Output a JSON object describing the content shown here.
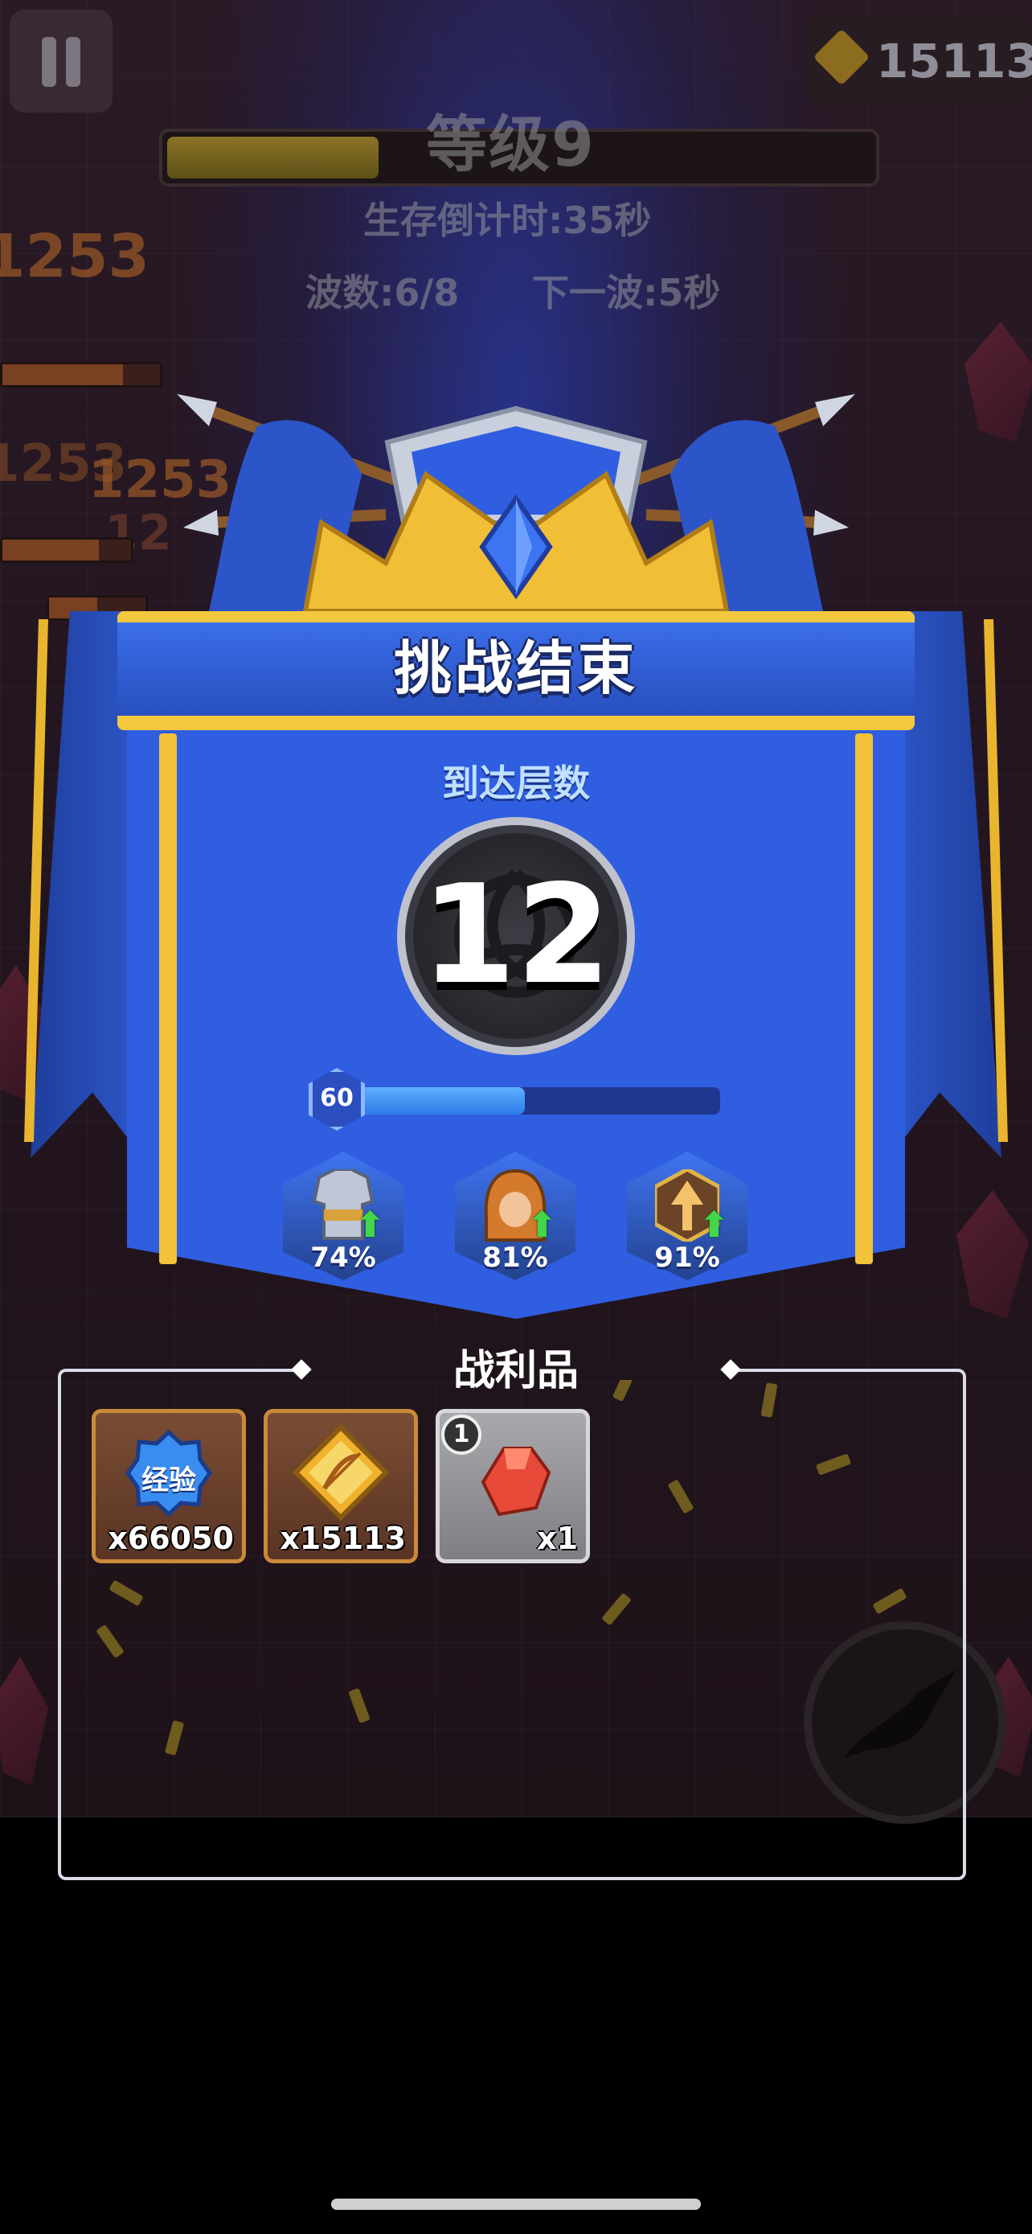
{
  "hud": {
    "level": "等级9",
    "level_progress": 0.3,
    "survival_countdown": "生存倒计时:35秒",
    "wave": "波数:6/8",
    "next_wave": "下一波:5秒",
    "coins": "15113"
  },
  "background_damage_numbers": [
    "1253",
    "1253",
    "1253",
    "12"
  ],
  "result": {
    "title": "挑战结束",
    "floor_label": "到达层数",
    "floor_value": "12",
    "player_level": "60",
    "xp_progress": 0.5,
    "stats": [
      {
        "icon": "armor-icon",
        "percent": "74%"
      },
      {
        "icon": "hero-icon",
        "percent": "81%"
      },
      {
        "icon": "arrow-upgrade-icon",
        "percent": "91%"
      }
    ]
  },
  "loot": {
    "title": "战利品",
    "items": [
      {
        "icon": "exp-badge-icon",
        "icon_text": "经验",
        "quantity": "x66050"
      },
      {
        "icon": "coin-icon",
        "quantity": "x15113"
      },
      {
        "icon": "red-gem-icon",
        "badge": "1",
        "quantity": "x1"
      }
    ]
  },
  "colors": {
    "banner_blue": "#2f5ee0",
    "gold_trim": "#f4c83c",
    "xp_fill": "#3a8df0",
    "upgrade_arrow": "#43d64a"
  }
}
